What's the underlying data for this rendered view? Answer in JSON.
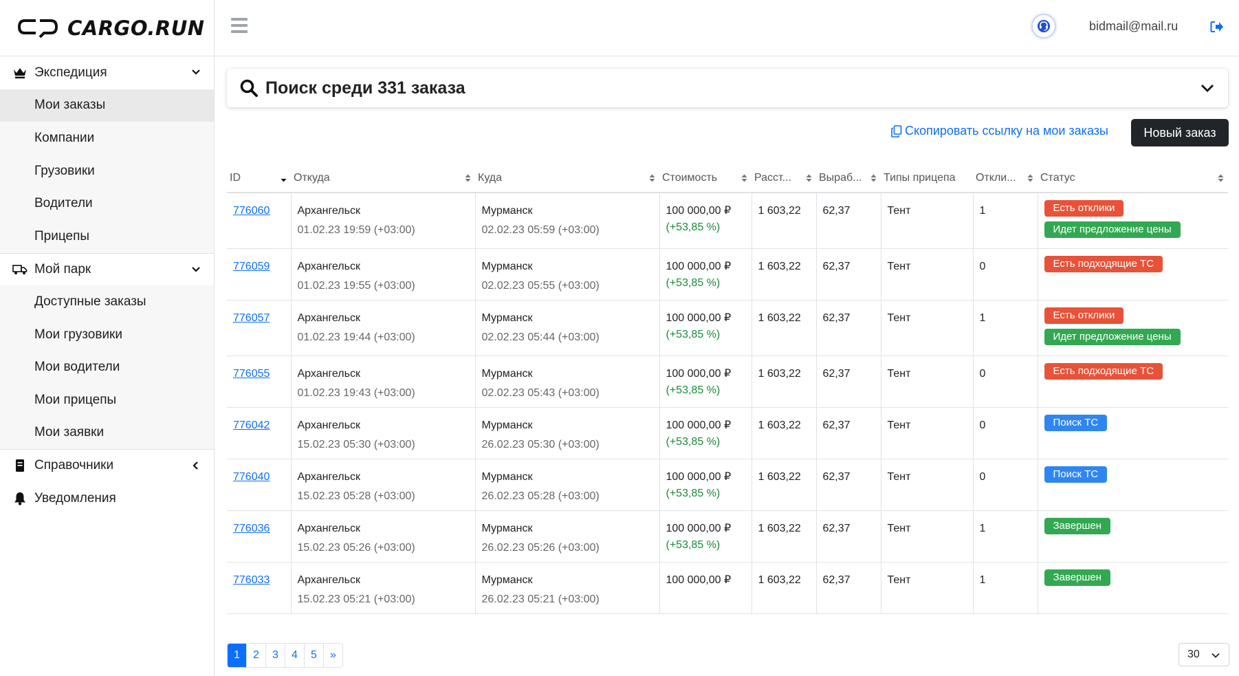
{
  "brand": {
    "name": "CARGO.RUN"
  },
  "header": {
    "user_email": "bidmail@mail.ru"
  },
  "sidebar": {
    "groups": [
      {
        "label": "Экспедиция",
        "icon": "crown-icon",
        "expanded": true,
        "items": [
          {
            "label": "Мои заказы",
            "active": true
          },
          {
            "label": "Компании"
          },
          {
            "label": "Грузовики"
          },
          {
            "label": "Водители"
          },
          {
            "label": "Прицепы"
          }
        ]
      },
      {
        "label": "Мой парк",
        "icon": "truck-icon",
        "expanded": true,
        "items": [
          {
            "label": "Доступные заказы"
          },
          {
            "label": "Мои грузовики"
          },
          {
            "label": "Мои водители"
          },
          {
            "label": "Мои прицепы"
          },
          {
            "label": "Мои заявки"
          }
        ]
      },
      {
        "label": "Справочники",
        "icon": "book-icon",
        "expanded": false
      },
      {
        "label": "Уведомления",
        "icon": "bell-icon"
      }
    ]
  },
  "search": {
    "title": "Поиск среди 331 заказа"
  },
  "actions": {
    "copy_link": "Скопировать ссылку на мои заказы",
    "new_order": "Новый заказ"
  },
  "table": {
    "columns": [
      "ID",
      "Откуда",
      "Куда",
      "Стоимость",
      "Расстояние",
      "Выработка",
      "Типы прицепа",
      "Отклики",
      "Статус"
    ],
    "columns_display": [
      "ID",
      "Откуда",
      "Куда",
      "Стоимость",
      "Расст...",
      "Выраб...",
      "Типы прицепа",
      "Откли...",
      "Статус"
    ],
    "rows": [
      {
        "id": "776060",
        "from": "Архангельск",
        "from_date": "01.02.23 19:59 (+03:00)",
        "to": "Мурманск",
        "to_date": "02.02.23 05:59 (+03:00)",
        "price": "100 000,00 ₽",
        "price_pct": "(+53,85 %)",
        "distance": "1 603,22",
        "yield": "62,37",
        "trailer": "Тент",
        "responses": "1",
        "statuses": [
          {
            "text": "Есть отклики",
            "color": "red"
          },
          {
            "text": "Идет предложение цены",
            "color": "green"
          }
        ]
      },
      {
        "id": "776059",
        "from": "Архангельск",
        "from_date": "01.02.23 19:55 (+03:00)",
        "to": "Мурманск",
        "to_date": "02.02.23 05:55 (+03:00)",
        "price": "100 000,00 ₽",
        "price_pct": "(+53,85 %)",
        "distance": "1 603,22",
        "yield": "62,37",
        "trailer": "Тент",
        "responses": "0",
        "statuses": [
          {
            "text": "Есть подходящие ТС",
            "color": "red"
          }
        ]
      },
      {
        "id": "776057",
        "from": "Архангельск",
        "from_date": "01.02.23 19:44 (+03:00)",
        "to": "Мурманск",
        "to_date": "02.02.23 05:44 (+03:00)",
        "price": "100 000,00 ₽",
        "price_pct": "(+53,85 %)",
        "distance": "1 603,22",
        "yield": "62,37",
        "trailer": "Тент",
        "responses": "1",
        "statuses": [
          {
            "text": "Есть отклики",
            "color": "red"
          },
          {
            "text": "Идет предложение цены",
            "color": "green"
          }
        ]
      },
      {
        "id": "776055",
        "from": "Архангельск",
        "from_date": "01.02.23 19:43 (+03:00)",
        "to": "Мурманск",
        "to_date": "02.02.23 05:43 (+03:00)",
        "price": "100 000,00 ₽",
        "price_pct": "(+53,85 %)",
        "distance": "1 603,22",
        "yield": "62,37",
        "trailer": "Тент",
        "responses": "0",
        "statuses": [
          {
            "text": "Есть подходящие ТС",
            "color": "red"
          }
        ]
      },
      {
        "id": "776042",
        "from": "Архангельск",
        "from_date": "15.02.23 05:30 (+03:00)",
        "to": "Мурманск",
        "to_date": "26.02.23 05:30 (+03:00)",
        "price": "100 000,00 ₽",
        "price_pct": "(+53,85 %)",
        "distance": "1 603,22",
        "yield": "62,37",
        "trailer": "Тент",
        "responses": "0",
        "statuses": [
          {
            "text": "Поиск ТС",
            "color": "blue"
          }
        ]
      },
      {
        "id": "776040",
        "from": "Архангельск",
        "from_date": "15.02.23 05:28 (+03:00)",
        "to": "Мурманск",
        "to_date": "26.02.23 05:28 (+03:00)",
        "price": "100 000,00 ₽",
        "price_pct": "(+53,85 %)",
        "distance": "1 603,22",
        "yield": "62,37",
        "trailer": "Тент",
        "responses": "0",
        "statuses": [
          {
            "text": "Поиск ТС",
            "color": "blue"
          }
        ]
      },
      {
        "id": "776036",
        "from": "Архангельск",
        "from_date": "15.02.23 05:26 (+03:00)",
        "to": "Мурманск",
        "to_date": "26.02.23 05:26 (+03:00)",
        "price": "100 000,00 ₽",
        "price_pct": "(+53,85 %)",
        "distance": "1 603,22",
        "yield": "62,37",
        "trailer": "Тент",
        "responses": "1",
        "statuses": [
          {
            "text": "Завершен",
            "color": "green"
          }
        ]
      },
      {
        "id": "776033",
        "from": "Архангельск",
        "from_date": "15.02.23 05:21 (+03:00)",
        "to": "Мурманск",
        "to_date": "26.02.23 05:21 (+03:00)",
        "price": "100 000,00 ₽",
        "price_pct": "",
        "distance": "1 603,22",
        "yield": "62,37",
        "trailer": "Тент",
        "responses": "1",
        "statuses": [
          {
            "text": "Завершен",
            "color": "green"
          }
        ]
      }
    ]
  },
  "pagination": {
    "pages": [
      "1",
      "2",
      "3",
      "4",
      "5"
    ],
    "next": "»",
    "current": "1"
  },
  "per_page": "30",
  "colors": {
    "accent": "#0d6efd",
    "dark_button": "#212529",
    "badge_red": "#e85238",
    "badge_green": "#33a852",
    "badge_blue": "#2f86f2",
    "price_pct": "#1a8a3a"
  }
}
